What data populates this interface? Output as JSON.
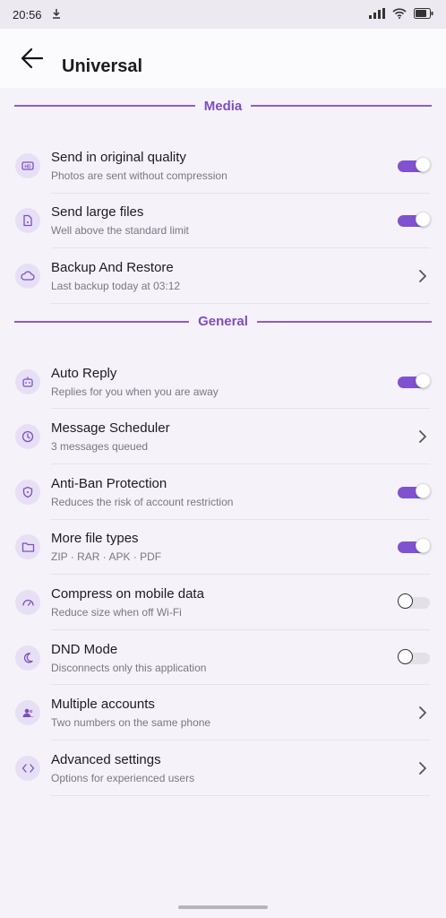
{
  "status": {
    "time": "20:56"
  },
  "header": {
    "title": "Universal"
  },
  "sections": [
    {
      "label": "Media"
    },
    {
      "label": "General"
    }
  ],
  "items": [
    {
      "title": "Send in original quality",
      "subtitle": "Photos are sent without compression",
      "control": "on",
      "icon": "hd-icon"
    },
    {
      "title": "Send large files",
      "subtitle": "Well above the standard limit",
      "control": "on",
      "icon": "file-icon"
    },
    {
      "title": "Backup And Restore",
      "subtitle": "Last backup today at 03:12",
      "control": "chevron",
      "icon": "cloud-icon"
    },
    {
      "title": "Auto Reply",
      "subtitle": "Replies for you when you are away",
      "control": "on",
      "icon": "robot-icon"
    },
    {
      "title": "Message Scheduler",
      "subtitle": "3 messages queued",
      "control": "chevron",
      "icon": "clock-icon"
    },
    {
      "title": "Anti-Ban Protection",
      "subtitle": "Reduces the risk of account restriction",
      "control": "on",
      "icon": "shield-icon"
    },
    {
      "title": "More file types",
      "subtitle": "ZIP · RAR · APK · PDF",
      "control": "on",
      "icon": "folder-icon"
    },
    {
      "title": "Compress on mobile data",
      "subtitle": "Reduce size when off Wi-Fi",
      "control": "off",
      "icon": "gauge-icon"
    },
    {
      "title": "DND Mode",
      "subtitle": "Disconnects only this application",
      "control": "off",
      "icon": "moon-icon"
    },
    {
      "title": "Multiple accounts",
      "subtitle": "Two numbers on the same phone",
      "control": "chevron",
      "icon": "users-icon"
    },
    {
      "title": "Advanced settings",
      "subtitle": "Options for experienced users",
      "control": "chevron",
      "icon": "code-icon"
    }
  ],
  "colors": {
    "accent": "#8052cf",
    "background": "#f5f2fa",
    "icon_bg": "#e7e0f5"
  }
}
